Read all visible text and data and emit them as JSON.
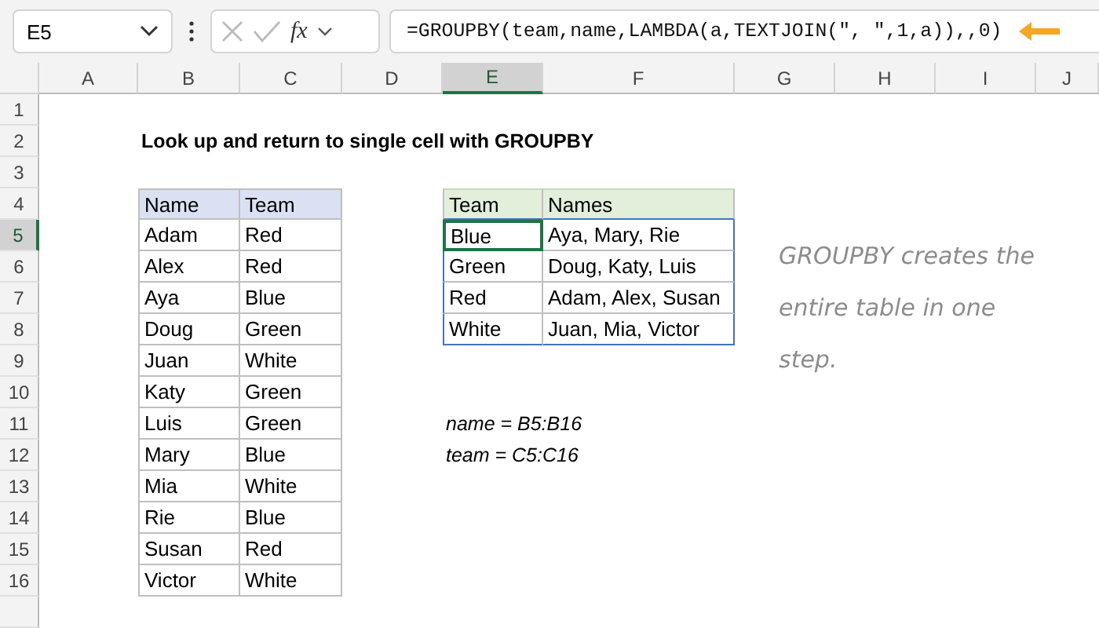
{
  "name_box": {
    "value": "E5"
  },
  "formula_bar": {
    "function_label": "fx",
    "value": "=GROUPBY(team,name,LAMBDA(a,TEXTJOIN(\", \",1,a)),,0)"
  },
  "columns": [
    {
      "label": "A",
      "selected": false
    },
    {
      "label": "B",
      "selected": false
    },
    {
      "label": "C",
      "selected": false
    },
    {
      "label": "D",
      "selected": false
    },
    {
      "label": "E",
      "selected": true
    },
    {
      "label": "F",
      "selected": false
    },
    {
      "label": "G",
      "selected": false
    },
    {
      "label": "H",
      "selected": false
    },
    {
      "label": "I",
      "selected": false
    },
    {
      "label": "J",
      "selected": false
    }
  ],
  "rows": [
    {
      "label": "1",
      "selected": false
    },
    {
      "label": "2",
      "selected": false
    },
    {
      "label": "3",
      "selected": false
    },
    {
      "label": "4",
      "selected": false
    },
    {
      "label": "5",
      "selected": true
    },
    {
      "label": "6",
      "selected": false
    },
    {
      "label": "7",
      "selected": false
    },
    {
      "label": "8",
      "selected": false
    },
    {
      "label": "9",
      "selected": false
    },
    {
      "label": "10",
      "selected": false
    },
    {
      "label": "11",
      "selected": false
    },
    {
      "label": "12",
      "selected": false
    },
    {
      "label": "13",
      "selected": false
    },
    {
      "label": "14",
      "selected": false
    },
    {
      "label": "15",
      "selected": false
    },
    {
      "label": "16",
      "selected": false
    }
  ],
  "title": "Look up and return to single cell with GROUPBY",
  "source_table": {
    "columns": [
      "Name",
      "Team"
    ],
    "rows": [
      [
        "Adam",
        "Red"
      ],
      [
        "Alex",
        "Red"
      ],
      [
        "Aya",
        "Blue"
      ],
      [
        "Doug",
        "Green"
      ],
      [
        "Juan",
        "White"
      ],
      [
        "Katy",
        "Green"
      ],
      [
        "Luis",
        "Green"
      ],
      [
        "Mary",
        "Blue"
      ],
      [
        "Mia",
        "White"
      ],
      [
        "Rie",
        "Blue"
      ],
      [
        "Susan",
        "Red"
      ],
      [
        "Victor",
        "White"
      ]
    ]
  },
  "result_table": {
    "columns": [
      "Team",
      "Names"
    ],
    "rows": [
      {
        "team": "Blue",
        "names": "Aya, Mary, Rie",
        "selected": true
      },
      {
        "team": "Green",
        "names": "Doug, Katy, Luis",
        "selected": false
      },
      {
        "team": "Red",
        "names": "Adam, Alex, Susan",
        "selected": false
      },
      {
        "team": "White",
        "names": "Juan, Mia, Victor",
        "selected": false
      }
    ]
  },
  "named_ranges": [
    "name = B5:B16",
    "team = C5:C16"
  ],
  "note": "GROUPBY creates the entire table in one step."
}
